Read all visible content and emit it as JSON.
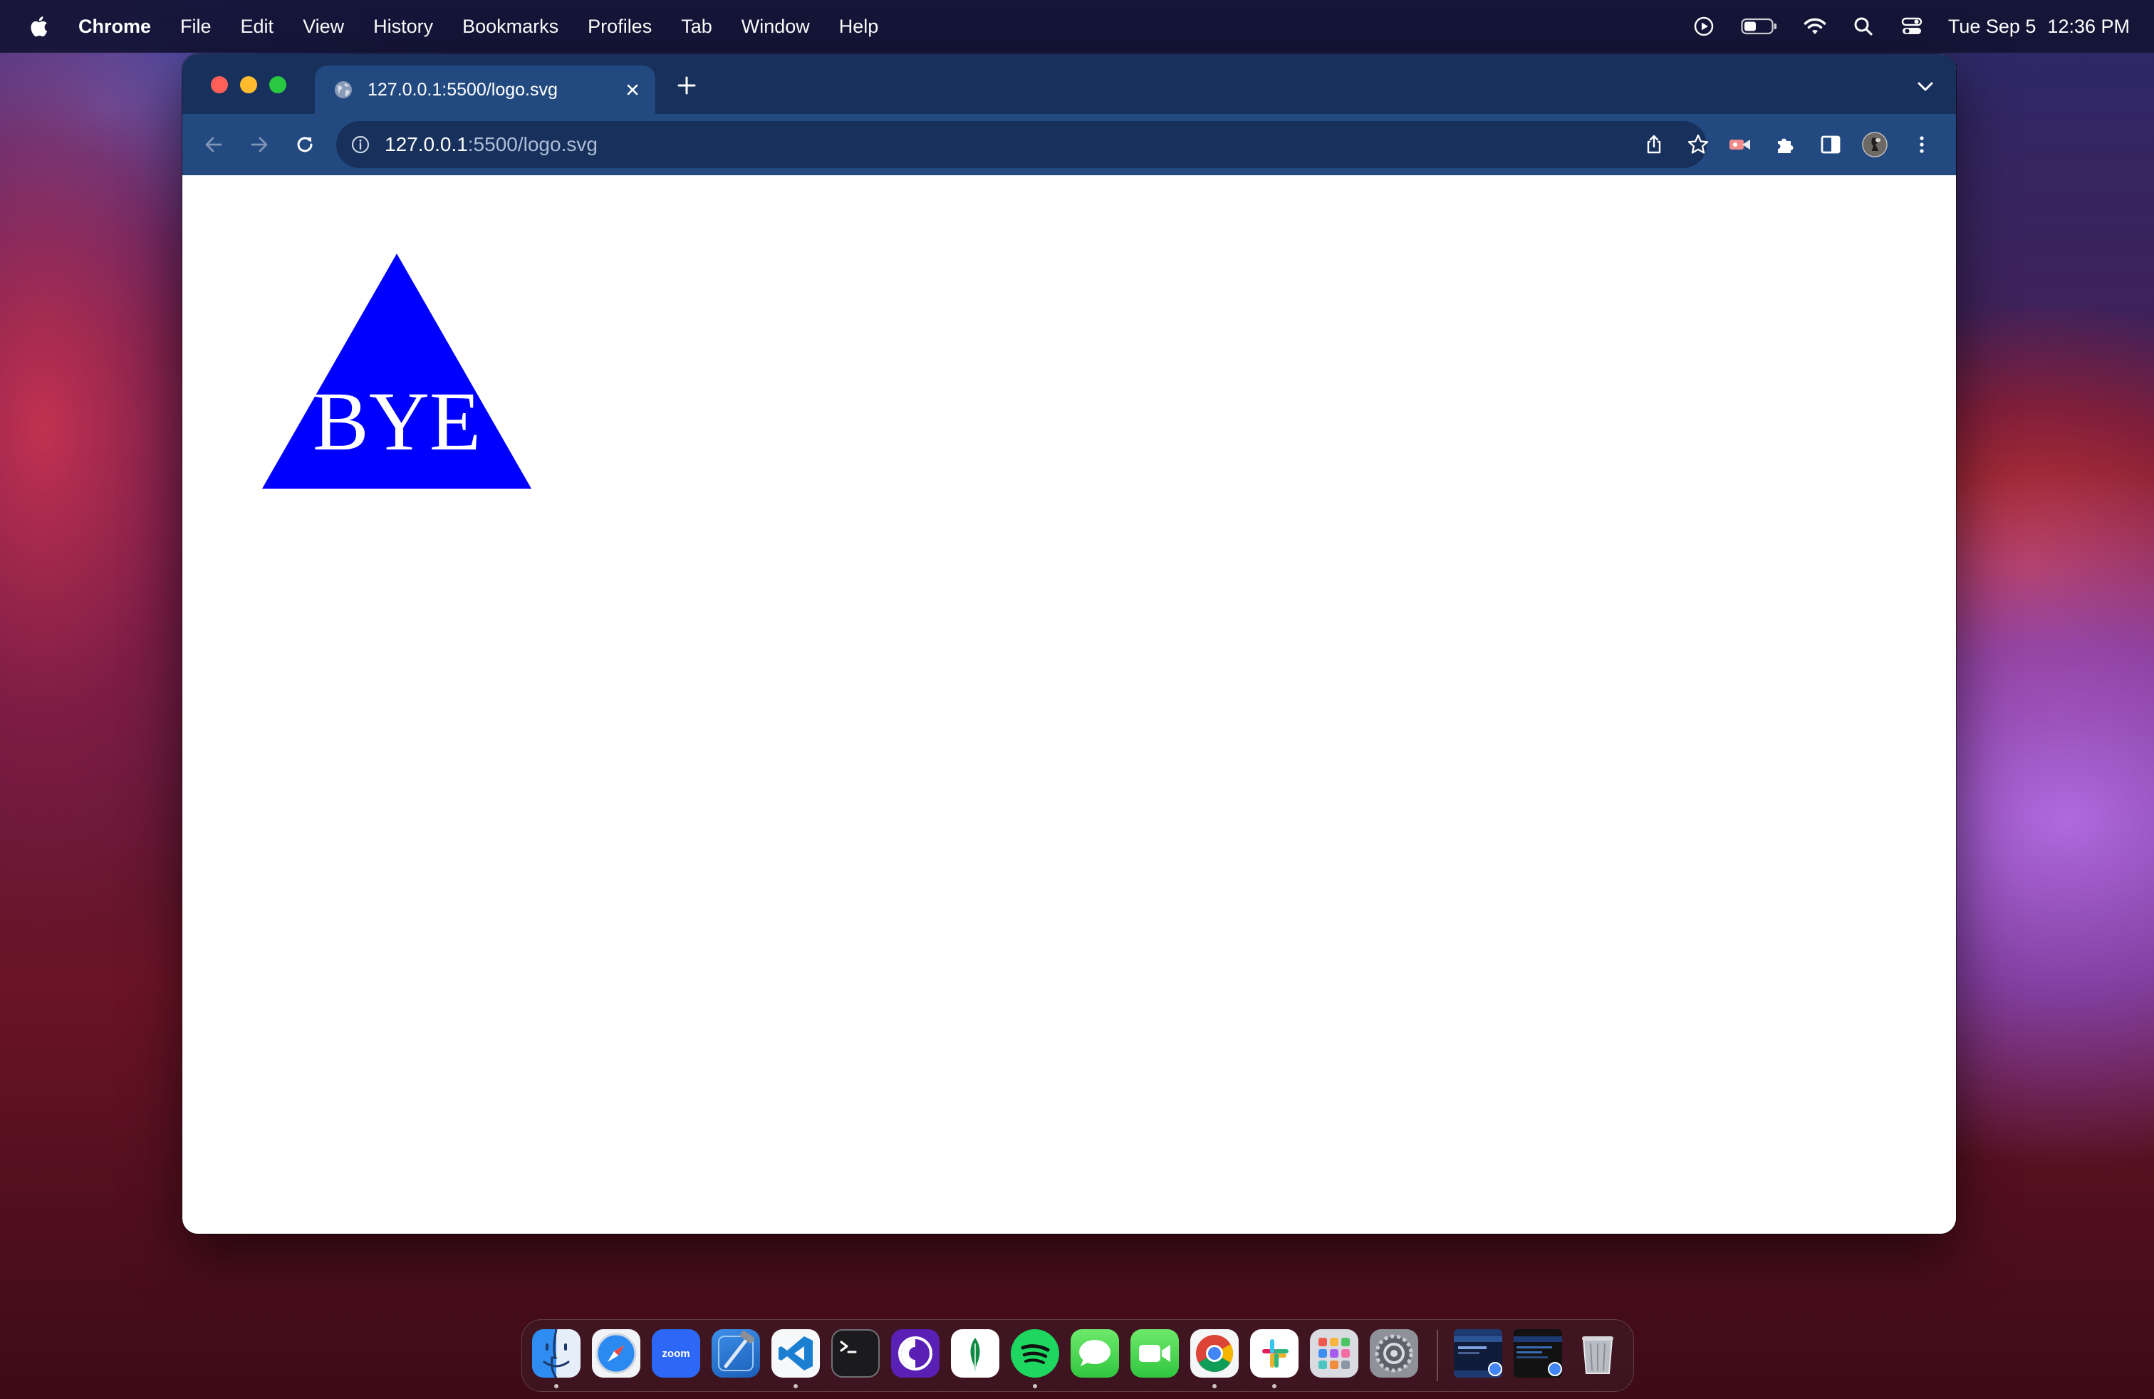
{
  "menubar": {
    "app_name": "Chrome",
    "menus": [
      "File",
      "Edit",
      "View",
      "History",
      "Bookmarks",
      "Profiles",
      "Tab",
      "Window",
      "Help"
    ],
    "date": "Tue Sep 5",
    "time": "12:36 PM",
    "status_icons": [
      "screen-recording-icon",
      "battery-icon",
      "wifi-icon",
      "spotlight-search-icon",
      "control-center-icon"
    ]
  },
  "browser": {
    "tab": {
      "title": "127.0.0.1:5500/logo.svg",
      "favicon": "globe-icon"
    },
    "omnibox": {
      "host": "127.0.0.1",
      "path": ":5500/logo.svg"
    },
    "toolbar_icons": [
      "back-arrow-icon",
      "forward-arrow-icon",
      "reload-icon",
      "share-icon",
      "bookmark-star-icon",
      "extension-icon",
      "puzzle-extensions-icon",
      "side-panel-icon",
      "profile-avatar",
      "more-menu-icon"
    ]
  },
  "page": {
    "logo": {
      "text": "BYE",
      "fill": "#0000ff",
      "text_color": "#ffffff"
    }
  },
  "dock": {
    "apps": [
      "Finder",
      "Safari",
      "zoom",
      "Xcode",
      "Visual Studio Code",
      "Terminal",
      "Tor Browser",
      "MongoDB Compass",
      "Spotify",
      "Messages",
      "FaceTime",
      "Google Chrome",
      "Slack",
      "Launchpad",
      "System Settings"
    ],
    "zoom_label": "zoom"
  },
  "colors": {
    "menubar_bg": "#141434",
    "tabstrip_bg": "#17305c",
    "toolbar_bg": "#234a80",
    "logo_blue": "#0000ff"
  }
}
